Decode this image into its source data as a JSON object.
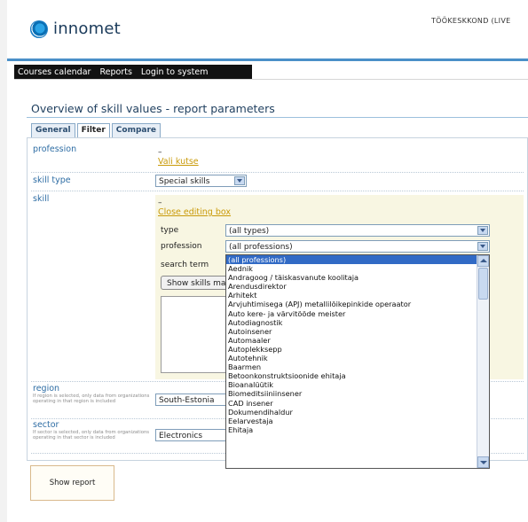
{
  "header": {
    "logo_text": "innomet",
    "top_right": "TÖÖKESKKOND (LIVE"
  },
  "nav": [
    "Courses calendar",
    "Reports",
    "Login to system"
  ],
  "page_title": "Overview of skill values - report parameters",
  "tabs": [
    "General",
    "Filter",
    "Compare"
  ],
  "active_tab": "Filter",
  "form": {
    "profession": {
      "label": "profession",
      "value": "–",
      "link": "Vali kutse"
    },
    "skill_type": {
      "label": "skill type",
      "value": "Special skills"
    },
    "skill": {
      "label": "skill",
      "value": "–",
      "link": "Close editing box",
      "type_label": "type",
      "type_value": "(all types)",
      "profession_label": "profession",
      "profession_value": "(all professions)",
      "search_label": "search term",
      "search_button": "Show skills matching"
    },
    "region": {
      "label": "region",
      "note": "If region is selected, only data from organizations operating in that region is included",
      "value": "South-Estonia"
    },
    "sector": {
      "label": "sector",
      "note": "If sector is selected, only data from organizations operating in that sector is included",
      "value": "Electronics"
    }
  },
  "show_report_button": "Show report",
  "profession_options": [
    "(all professions)",
    "Aednik",
    "Andragoog / täiskasvanute koolitaja",
    "Arendusdirektor",
    "Arhitekt",
    "Arvjuhtimisega (APJ) metallilõikepinkide operaator",
    "Auto kere- ja värvitööde meister",
    "Autodiagnostik",
    "Autoinsener",
    "Automaaler",
    "Autoplekksepp",
    "Autotehnik",
    "Baarmen",
    "Betoonkonstruktsioonide ehitaja",
    "Bioanalüütik",
    "Biomeditsiiniinsener",
    "CAD insener",
    "Dokumendihaldur",
    "Eelarvestaja",
    "Ehitaja"
  ],
  "colors": {
    "accent_blue": "#4a90c8",
    "link": "#c99a08",
    "label": "#2e6da4",
    "selection": "#316ac5"
  }
}
